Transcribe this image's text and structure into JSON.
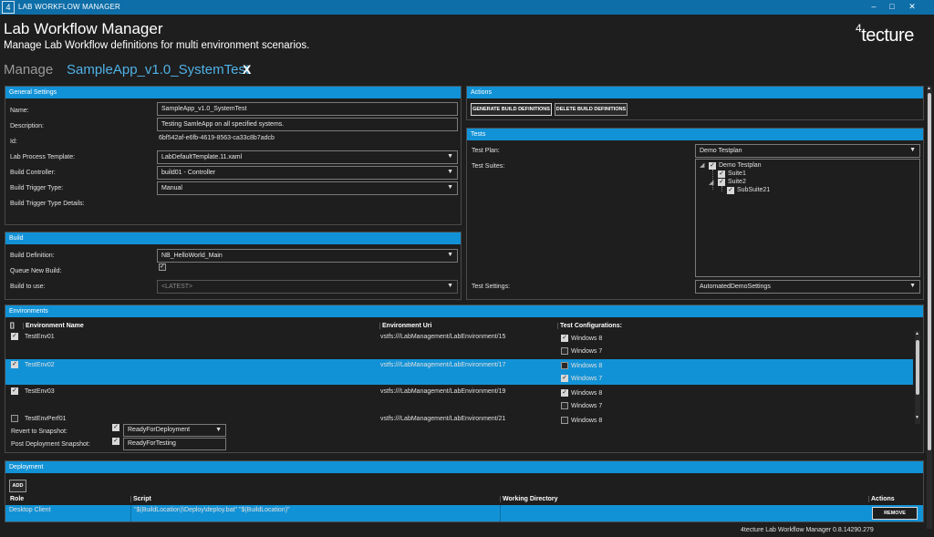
{
  "window": {
    "logo": "4",
    "title": "LAB WORKFLOW MANAGER",
    "minimize_glyph": "–",
    "maximize_glyph": "□",
    "close_glyph": "✕"
  },
  "header": {
    "title": "Lab Workflow Manager",
    "subtitle": "Manage Lab Workflow definitions for multi environment scenarios.",
    "brand_sup": "4",
    "brand_rest": "tecture",
    "tab_manage": "Manage",
    "tab_active": "SampleApp_v1.0_SystemTest",
    "tab_close": "X"
  },
  "general": {
    "heading": "General Settings",
    "name_label": "Name:",
    "name_value": "SampleApp_v1.0_SystemTest",
    "desc_label": "Description:",
    "desc_value": "Testing SamleApp on all specified systems.",
    "id_label": "Id:",
    "id_value": "6bf542af-e6fb-4619-8563-ca33c8b7adcb",
    "template_label": "Lab Process Template:",
    "template_value": "LabDefaultTemplate.11.xaml",
    "controller_label": "Build Controller:",
    "controller_value": "build01 - Controller",
    "trigger_label": "Build Trigger Type:",
    "trigger_value": "Manual",
    "trigger_details_label": "Build Trigger Type Details:"
  },
  "build": {
    "heading": "Build",
    "definition_label": "Build Definition:",
    "definition_value": "NB_HelloWorld_Main",
    "queue_label": "Queue New Build:",
    "use_label": "Build to use:",
    "use_value": "<LATEST>"
  },
  "actions": {
    "heading": "Actions",
    "generate": "GENERATE BUILD DEFINITIONS",
    "delete": "DELETE BUILD DEFINITIONS"
  },
  "tests": {
    "heading": "Tests",
    "plan_label": "Test Plan:",
    "plan_value": "Demo Testplan",
    "suites_label": "Test Suites:",
    "tree": {
      "root": "Demo Testplan",
      "suite1": "Suite1",
      "suite2": "Suite2",
      "subsuite": "SubSuite21"
    },
    "settings_label": "Test Settings:",
    "settings_value": "AutomatedDemoSettings"
  },
  "environments": {
    "heading": "Environments",
    "col_check": "[]",
    "col_name": "Environment Name",
    "col_uri": "Environment Uri",
    "col_configs": "Test Configurations:",
    "rows": [
      {
        "name": "TestEnv01",
        "uri": "vstfs:///LabManagement/LabEnvironment/15",
        "c1": "Windows 8",
        "c2": "Windows 7"
      },
      {
        "name": "TestEnv02",
        "uri": "vstfs:///LabManagement/LabEnvironment/17",
        "c1": "Windows 8",
        "c2": "Windows 7"
      },
      {
        "name": "TestEnv03",
        "uri": "vstfs:///LabManagement/LabEnvironment/19",
        "c1": "Windows 8",
        "c2": "Windows 7"
      },
      {
        "name": "TestEnvPerf01",
        "uri": "vstfs:///LabManagement/LabEnvironment/21",
        "c1": "Windows 8"
      }
    ],
    "revert_label": "Revert to Snapshot:",
    "revert_value": "ReadyForDeployment",
    "post_label": "Post Deployment Snapshot:",
    "post_value": "ReadyForTesting"
  },
  "deployment": {
    "heading": "Deployment",
    "add": "ADD",
    "col_role": "Role",
    "col_script": "Script",
    "col_workdir": "Working Directory",
    "col_actions": "Actions",
    "row_role": "Desktop Client",
    "row_script": "\"$(BuildLocation)\\Deploy\\deploy.bat\" \"$(BuildLocation)\"",
    "remove": "REMOVE"
  },
  "footer": {
    "version": "4tecture Lab Workflow Manager 0.8.14290.279"
  },
  "colors": {
    "accent": "#1292d6",
    "titlebar": "#0e6ea8",
    "background": "#1e1e1e"
  }
}
